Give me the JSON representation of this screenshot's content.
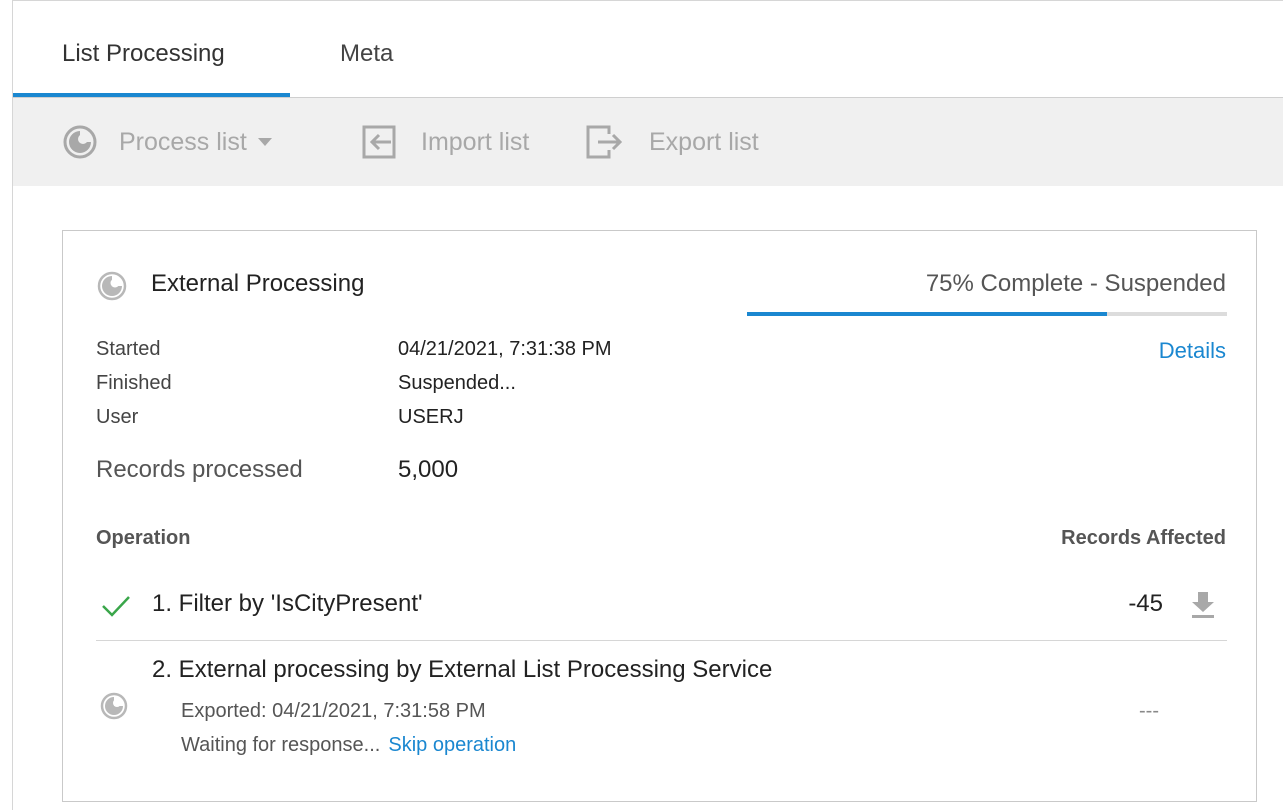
{
  "tabs": [
    {
      "label": "List Processing",
      "active": true
    },
    {
      "label": "Meta",
      "active": false
    }
  ],
  "toolbar": {
    "process_label": "Process list",
    "import_label": "Import list",
    "export_label": "Export list"
  },
  "card": {
    "title": "External Processing",
    "status": "75% Complete - Suspended",
    "progress_percent": 75,
    "details_label": "Details",
    "fields": [
      {
        "label": "Started",
        "value": "04/21/2021, 7:31:38 PM"
      },
      {
        "label": "Finished",
        "value": "Suspended..."
      },
      {
        "label": "User",
        "value": "USERJ"
      }
    ],
    "records_label": "Records processed",
    "records_value": "5,000",
    "operation_header": "Operation",
    "records_affected_header": "Records Affected",
    "operations": [
      {
        "text": "1. Filter by 'IsCityPresent'",
        "count": "-45",
        "status": "complete"
      },
      {
        "text": "2. External processing by External List Processing Service",
        "exported": "Exported: 04/21/2021, 7:31:58 PM",
        "waiting": "Waiting for response...",
        "skip_label": "Skip operation",
        "count": "---",
        "status": "processing"
      }
    ]
  },
  "colors": {
    "accent": "#1a87d0",
    "check": "#3aa64a",
    "toolbar_bg": "#f0f0f0",
    "disabled": "#a8a8a8"
  },
  "icons": [
    "processing-icon",
    "caret-down-icon",
    "import-icon",
    "export-icon",
    "check-icon",
    "download-icon"
  ]
}
